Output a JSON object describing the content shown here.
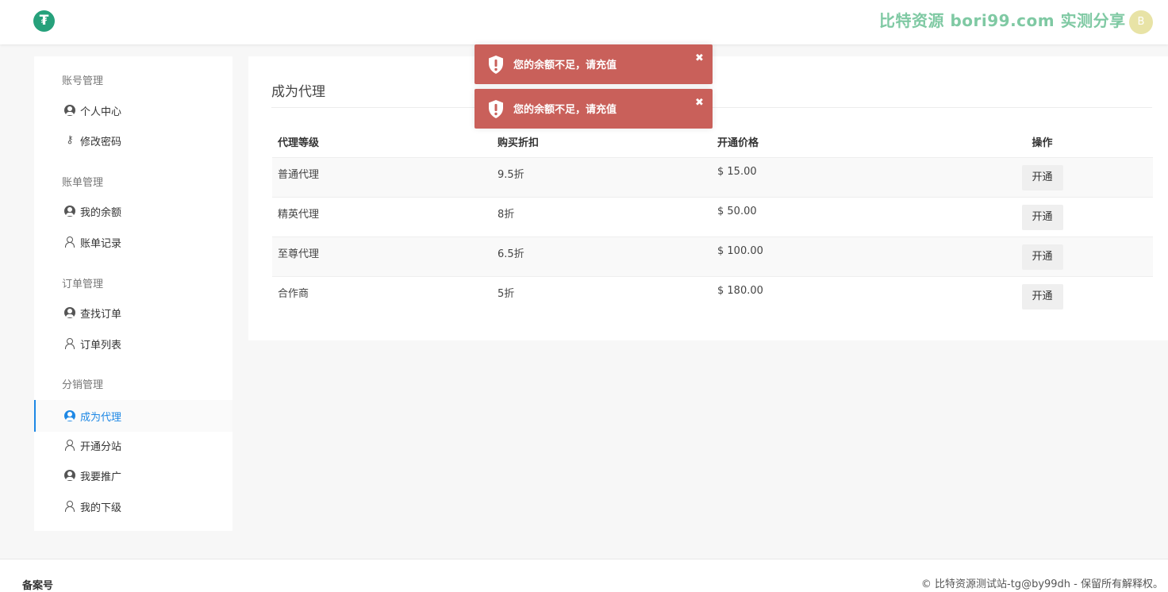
{
  "header": {
    "logo_text": "₮",
    "watermark": "比特资源 bori99.com 实测分享",
    "avatar_text": "B"
  },
  "sidebar": {
    "groups": [
      {
        "title": "账号管理",
        "items": [
          {
            "label": "个人中心",
            "icon": "user-solid-icon"
          },
          {
            "label": "修改密码",
            "icon": "key-icon"
          }
        ]
      },
      {
        "title": "账单管理",
        "items": [
          {
            "label": "我的余额",
            "icon": "user-solid-icon"
          },
          {
            "label": "账单记录",
            "icon": "user-outline-icon"
          }
        ]
      },
      {
        "title": "订单管理",
        "items": [
          {
            "label": "查找订单",
            "icon": "user-solid-icon"
          },
          {
            "label": "订单列表",
            "icon": "user-outline-icon"
          }
        ]
      },
      {
        "title": "分销管理",
        "items": [
          {
            "label": "成为代理",
            "icon": "user-solid-icon",
            "active": true
          },
          {
            "label": "开通分站",
            "icon": "user-outline-icon"
          },
          {
            "label": "我要推广",
            "icon": "user-solid-icon"
          },
          {
            "label": "我的下级",
            "icon": "user-outline-icon"
          }
        ]
      }
    ],
    "active_color": "#1e88e5"
  },
  "main": {
    "title": "成为代理",
    "table": {
      "headers": [
        "代理等级",
        "购买折扣",
        "开通价格",
        "操作"
      ],
      "rows": [
        {
          "level": "普通代理",
          "discount": "9.5折",
          "price": "$ 15.00",
          "action": "开通"
        },
        {
          "level": "精英代理",
          "discount": "8折",
          "price": "$ 50.00",
          "action": "开通"
        },
        {
          "level": "至尊代理",
          "discount": "6.5折",
          "price": "$ 100.00",
          "action": "开通"
        },
        {
          "level": "合作商",
          "discount": "5折",
          "price": "$ 180.00",
          "action": "开通"
        }
      ]
    }
  },
  "toasts": [
    {
      "message": "您的余额不足，请充值",
      "close": "✖"
    },
    {
      "message": "您的余额不足，请充值",
      "close": "✖"
    }
  ],
  "toast_color": "#c9605a",
  "footer": {
    "left": "备案号",
    "right": "© 比特资源测试站-tg@by99dh - 保留所有解释权。"
  }
}
